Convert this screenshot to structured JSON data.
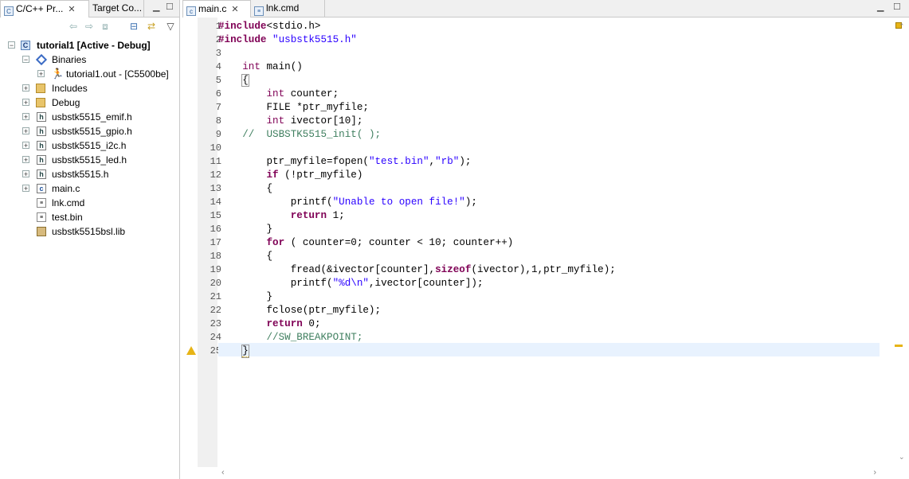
{
  "left_panel": {
    "tabs": [
      {
        "label": "C/C++ Pr...",
        "active": true
      },
      {
        "label": "Target Co...",
        "active": false
      }
    ],
    "toolbar_icons": [
      "back-icon",
      "forward-icon",
      "up-icon",
      "collapse-all-icon",
      "link-with-editor-icon",
      "view-menu-icon"
    ],
    "tree": [
      {
        "label": "tutorial1  [Active - Debug]",
        "icon": "project-icon",
        "level": 0,
        "expand": "−",
        "bold": true
      },
      {
        "label": "Binaries",
        "icon": "binaries-icon",
        "level": 1,
        "expand": "−"
      },
      {
        "label": "tutorial1.out - [C5500be]",
        "icon": "executable-icon",
        "level": 2,
        "expand": "+"
      },
      {
        "label": "Includes",
        "icon": "includes-folder-icon",
        "level": 1,
        "expand": "+"
      },
      {
        "label": "Debug",
        "icon": "folder-icon",
        "level": 1,
        "expand": "+"
      },
      {
        "label": "usbstk5515_emif.h",
        "icon": "header-file-icon",
        "level": 1,
        "expand": "+"
      },
      {
        "label": "usbstk5515_gpio.h",
        "icon": "header-file-icon",
        "level": 1,
        "expand": "+"
      },
      {
        "label": "usbstk5515_i2c.h",
        "icon": "header-file-icon",
        "level": 1,
        "expand": "+"
      },
      {
        "label": "usbstk5515_led.h",
        "icon": "header-file-icon",
        "level": 1,
        "expand": "+"
      },
      {
        "label": "usbstk5515.h",
        "icon": "header-file-icon",
        "level": 1,
        "expand": "+"
      },
      {
        "label": "main.c",
        "icon": "c-file-icon",
        "level": 1,
        "expand": "+"
      },
      {
        "label": "lnk.cmd",
        "icon": "cmd-file-icon",
        "level": 1,
        "expand": ""
      },
      {
        "label": "test.bin",
        "icon": "bin-file-icon",
        "level": 1,
        "expand": ""
      },
      {
        "label": "usbstk5515bsl.lib",
        "icon": "lib-file-icon",
        "level": 1,
        "expand": ""
      }
    ]
  },
  "editor": {
    "tabs": [
      {
        "label": "main.c",
        "active": true
      },
      {
        "label": "lnk.cmd",
        "active": false
      }
    ],
    "lines": [
      {
        "n": "1",
        "t": "#include<stdio.h>"
      },
      {
        "n": "2",
        "t": "#include \"usbstk5515.h\""
      },
      {
        "n": "3",
        "t": ""
      },
      {
        "n": "4",
        "t": "    int main()"
      },
      {
        "n": "5",
        "t": "    {"
      },
      {
        "n": "6",
        "t": "        int counter;"
      },
      {
        "n": "7",
        "t": "        FILE *ptr_myfile;"
      },
      {
        "n": "8",
        "t": "        int ivector[10];"
      },
      {
        "n": "9",
        "t": "    //  USBSTK5515_init( );"
      },
      {
        "n": "10",
        "t": ""
      },
      {
        "n": "11",
        "t": "        ptr_myfile=fopen(\"test.bin\",\"rb\");"
      },
      {
        "n": "12",
        "t": "        if (!ptr_myfile)"
      },
      {
        "n": "13",
        "t": "        {"
      },
      {
        "n": "14",
        "t": "            printf(\"Unable to open file!\");"
      },
      {
        "n": "15",
        "t": "            return 1;"
      },
      {
        "n": "16",
        "t": "        }"
      },
      {
        "n": "17",
        "t": "        for ( counter=0; counter < 10; counter++)"
      },
      {
        "n": "18",
        "t": "        {"
      },
      {
        "n": "19",
        "t": "            fread(&ivector[counter],sizeof(ivector),1,ptr_myfile);"
      },
      {
        "n": "20",
        "t": "            printf(\"%d\\n\",ivector[counter]);"
      },
      {
        "n": "21",
        "t": "        }"
      },
      {
        "n": "22",
        "t": "        fclose(ptr_myfile);"
      },
      {
        "n": "23",
        "t": "        return 0;"
      },
      {
        "n": "24",
        "t": "        //SW_BREAKPOINT;"
      },
      {
        "n": "25",
        "t": "    }"
      }
    ],
    "warning_line": "25",
    "current_line": "25"
  },
  "colors": {
    "keyword": "#7f0055",
    "string": "#2a00ff",
    "comment": "#3f7f5f",
    "current_line": "#e8f2fe"
  }
}
